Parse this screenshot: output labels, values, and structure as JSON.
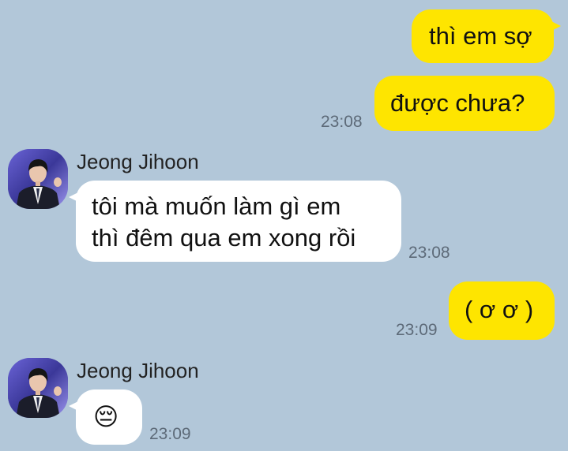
{
  "chat": {
    "messages": [
      {
        "id": "m1",
        "from": "me",
        "text": "thì em sợ"
      },
      {
        "id": "m2",
        "from": "me",
        "text": "được chưa?",
        "time": "23:08"
      },
      {
        "id": "m3",
        "from": "other",
        "sender": "Jeong Jihoon",
        "lines": [
          "tôi mà muốn làm gì em",
          "thì đêm qua em xong rồi"
        ],
        "time": "23:08"
      },
      {
        "id": "m4",
        "from": "me",
        "text": "( ơ ơ )",
        "time": "23:09"
      },
      {
        "id": "m5",
        "from": "other",
        "sender": "Jeong Jihoon",
        "text": "😔",
        "time": "23:09"
      }
    ]
  },
  "theme": {
    "background": "#b2c7d9",
    "my_bubble": "#fee500",
    "other_bubble": "#ffffff"
  },
  "icons": {
    "avatar": "profile-photo-man-in-suit",
    "emoji": "pensive-face"
  }
}
